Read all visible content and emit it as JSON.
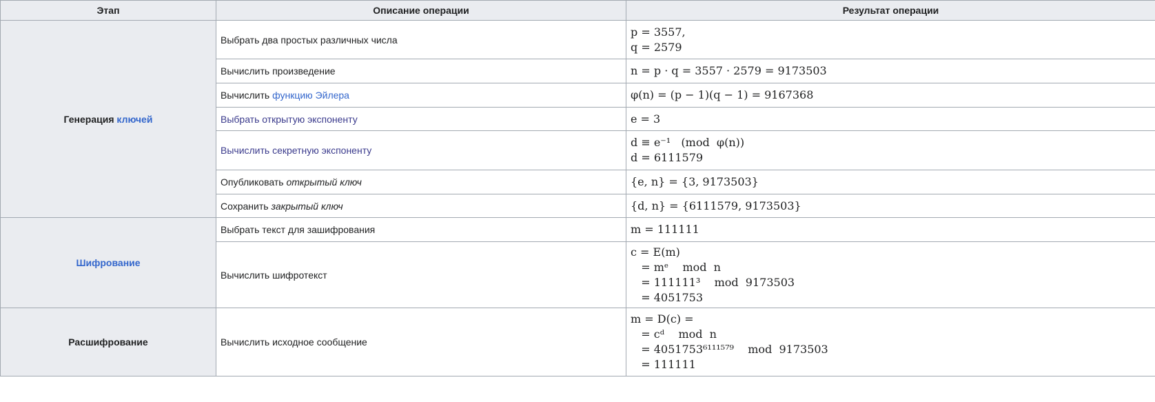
{
  "headers": {
    "stage": "Этап",
    "description": "Описание операции",
    "result": "Результат операции"
  },
  "stages": {
    "keygen_text": "Генерация ",
    "keygen_link": "ключей",
    "encrypt": "Шифрование",
    "decrypt": "Расшифрование"
  },
  "rows": {
    "r1": {
      "desc": "Выбрать два простых различных числа",
      "result": [
        "p = 3557,",
        "q = 2579"
      ]
    },
    "r2": {
      "desc": "Вычислить произведение",
      "result": [
        "n = p · q = 3557 · 2579 = 9173503"
      ]
    },
    "r3": {
      "desc_text": "Вычислить ",
      "desc_link": "функцию Эйлера",
      "result": [
        "φ(n) = (p − 1)(q − 1) = 9167368"
      ]
    },
    "r4": {
      "desc_link": "Выбрать открытую экспоненту",
      "result": [
        "e = 3"
      ]
    },
    "r5": {
      "desc_link": "Вычислить секретную экспоненту",
      "result": [
        "d ≡ e⁻¹   (mod  φ(n))",
        "d = 6111579"
      ]
    },
    "r6": {
      "desc_text": "Опубликовать ",
      "desc_em": "открытый ключ",
      "result": [
        "{e, n} = {3, 9173503}"
      ]
    },
    "r7": {
      "desc_text": "Сохранить ",
      "desc_em": "закрытый ключ",
      "result": [
        "{d, n} = {6111579, 9173503}"
      ]
    },
    "r8": {
      "desc": "Выбрать текст для зашифрования",
      "result": [
        "m = 111111"
      ]
    },
    "r9": {
      "desc": "Вычислить шифротекст",
      "result": [
        "c = E(m)",
        "   = mᵉ    mod  n",
        "   = 111111³    mod  9173503",
        "   = 4051753"
      ]
    },
    "r10": {
      "desc": "Вычислить исходное сообщение",
      "result": [
        "m = D(c) =",
        "   = cᵈ    mod  n",
        "   = 4051753⁶¹¹¹⁵⁷⁹    mod  9173503",
        "   = 111111"
      ]
    }
  }
}
